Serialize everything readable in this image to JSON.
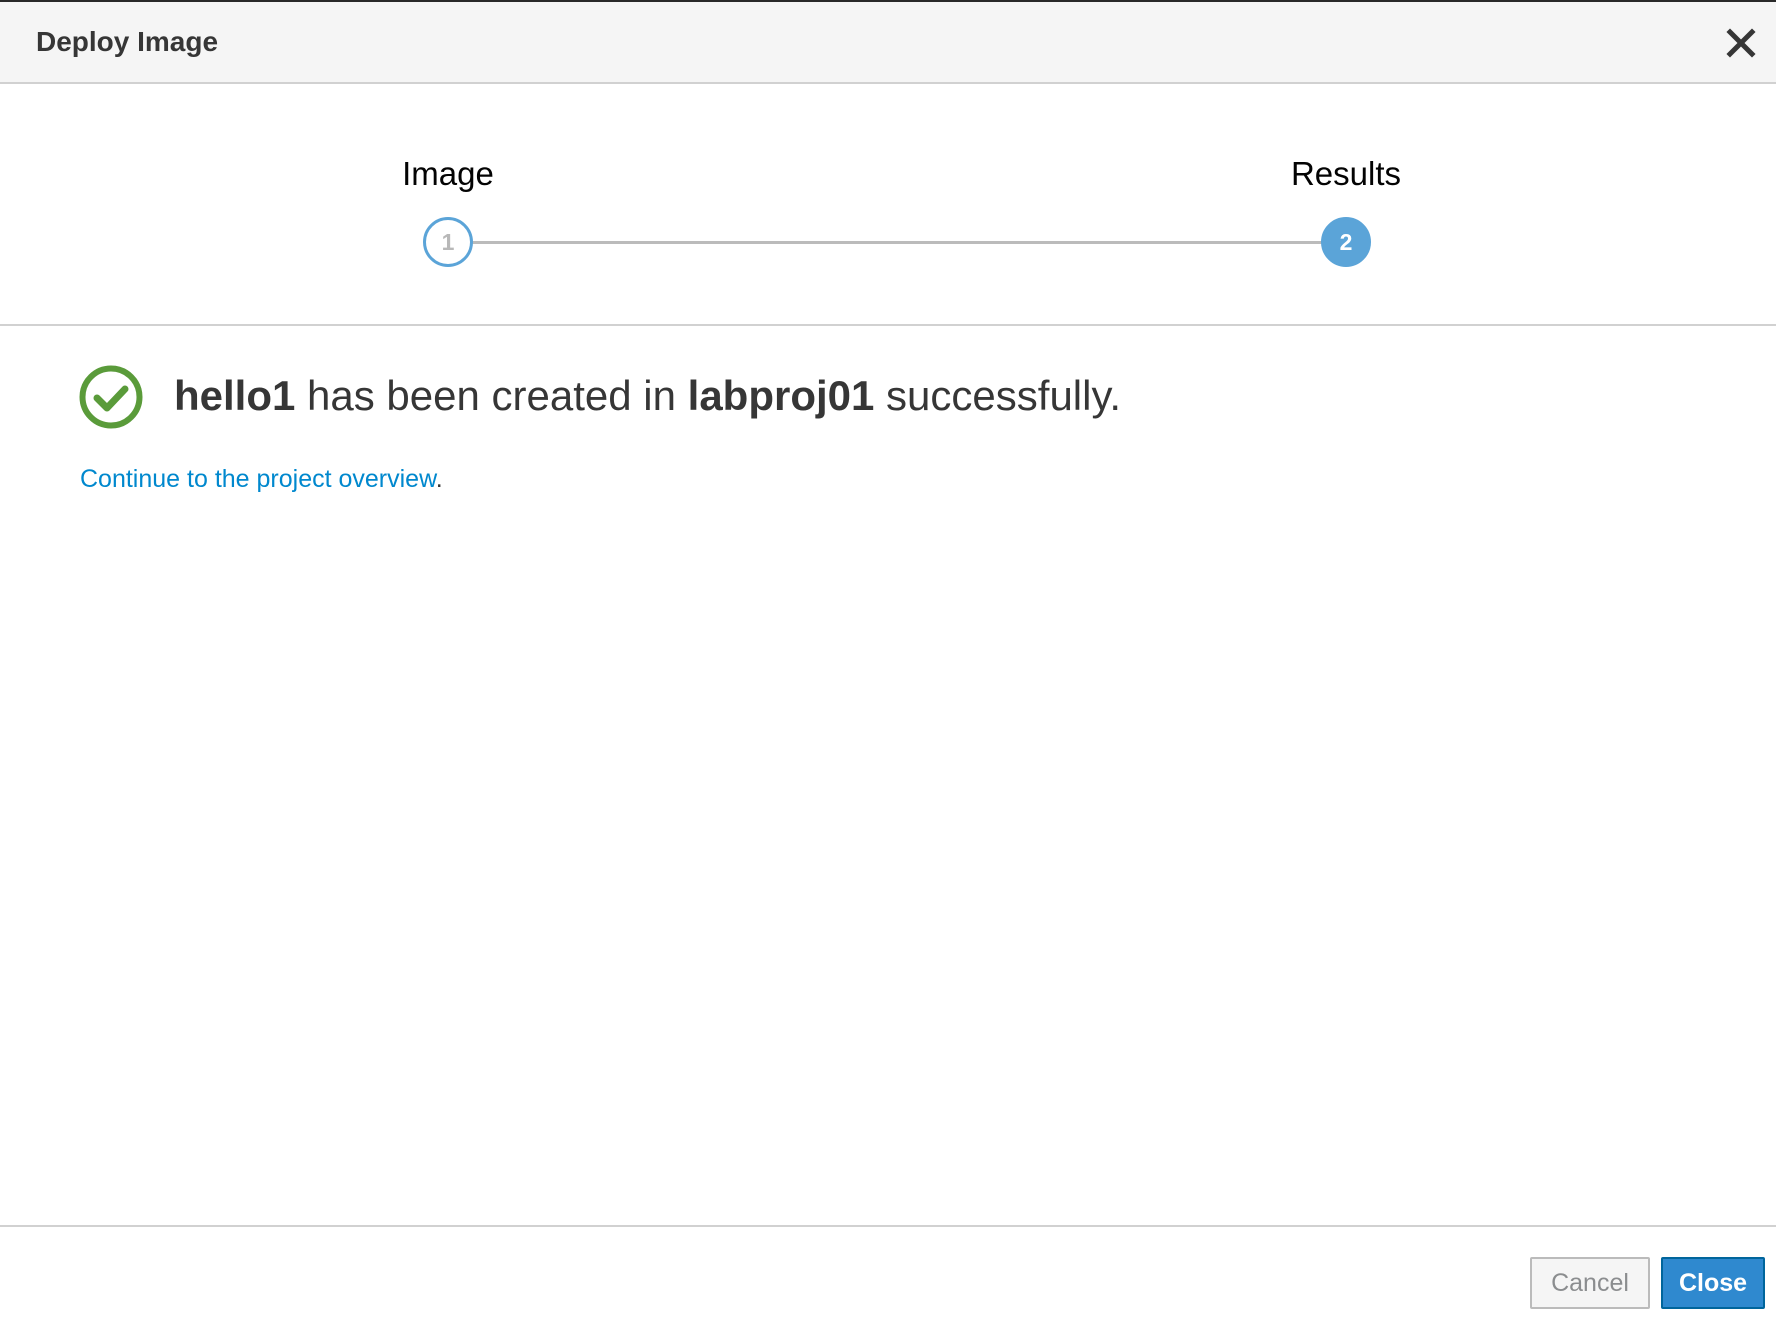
{
  "dialog": {
    "title": "Deploy Image",
    "close_icon": "close-icon"
  },
  "wizard": {
    "steps": [
      {
        "label": "Image",
        "number": "1",
        "state": "completed"
      },
      {
        "label": "Results",
        "number": "2",
        "state": "active"
      }
    ]
  },
  "result": {
    "icon": "check-circle-icon",
    "app_name": "hello1",
    "middle_text": " has been created in ",
    "project_name": "labproj01",
    "end_text": " successfully.",
    "link_text": "Continue to the project overview",
    "link_suffix": "."
  },
  "footer": {
    "cancel_label": "Cancel",
    "close_label": "Close"
  },
  "colors": {
    "accent": "#2f89cf",
    "success": "#5a9b3a",
    "step_blue": "#5ba4d8",
    "link": "#0088ce"
  }
}
